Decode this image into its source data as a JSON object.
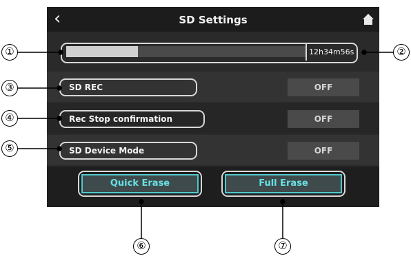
{
  "header": {
    "title": "SD Settings",
    "back_icon": "chevron-left-icon",
    "home_icon": "home-icon"
  },
  "capacity": {
    "remaining_time": "12h34m56s",
    "used_fraction": 0.3
  },
  "settings": [
    {
      "label": "SD REC",
      "value": "OFF"
    },
    {
      "label": "Rec Stop confirmation",
      "value": "OFF"
    },
    {
      "label": "SD Device Mode",
      "value": "OFF"
    }
  ],
  "buttons": {
    "quick_erase": "Quick Erase",
    "full_erase": "Full Erase"
  },
  "callouts": [
    "①",
    "②",
    "③",
    "④",
    "⑤",
    "⑥",
    "⑦"
  ],
  "colors": {
    "accent": "#4fc9cc",
    "background": "#2a2a2a"
  }
}
